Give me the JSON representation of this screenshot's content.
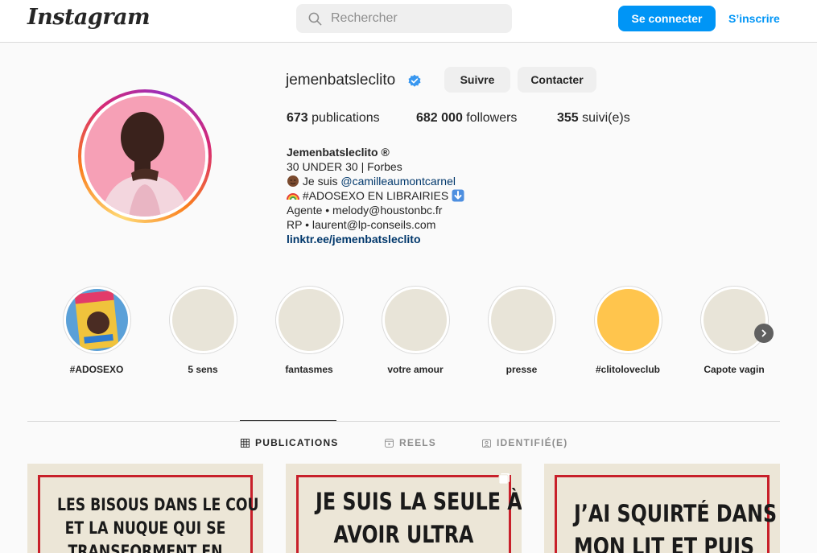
{
  "header": {
    "logo": "Instagram",
    "search_placeholder": "Rechercher",
    "login_label": "Se connecter",
    "signup_label": "S’inscrire"
  },
  "profile": {
    "username": "jemenbatsleclito",
    "verified": true,
    "follow_label": "Suivre",
    "contact_label": "Contacter",
    "stats": {
      "posts_count": "673",
      "posts_label": "publications",
      "followers_count": "682 000",
      "followers_label": "followers",
      "following_count": "355",
      "following_label": "suivi(e)s"
    },
    "bio": {
      "name": "Jemenbatsleclito ®",
      "line1": "30 UNDER 30 | Forbes",
      "line2_prefix": "Je suis ",
      "line2_mention": "@camilleaumontcarnel",
      "line3": "#ADOSEXO EN LIBRAIRIES",
      "line4": "Agente • melody@houstonbc.fr",
      "line5": "RP • laurent@lp-conseils.com",
      "link": "linktr.ee/jemenbatsleclito"
    }
  },
  "highlights": [
    {
      "label": "#ADOSEXO",
      "color": "#e8e4d8"
    },
    {
      "label": "5 sens",
      "color": "#e8e4d8"
    },
    {
      "label": "fantasmes",
      "color": "#e8e4d8"
    },
    {
      "label": "votre amour",
      "color": "#e8e4d8"
    },
    {
      "label": "presse",
      "color": "#e8e4d8"
    },
    {
      "label": "#clitoloveclub",
      "color": "#ffc54d"
    },
    {
      "label": "Capote vagin",
      "color": "#e8e4d8"
    }
  ],
  "tabs": {
    "publications": "PUBLICATIONS",
    "reels": "REELS",
    "tagged": "IDENTIFIÉ(E)"
  },
  "posts": [
    {
      "lines": [
        "LES BISOUS DANS LE COU",
        "ET LA NUQUE QUI SE",
        "TRANSFORMENT EN"
      ]
    },
    {
      "lines": [
        "JE SUIS LA SEULE À",
        "AVOIR ULTRA"
      ]
    },
    {
      "lines": [
        "J’AI SQUIRTÉ DANS",
        "MON LIT ET PUIS"
      ]
    }
  ],
  "colors": {
    "accent": "#0095f6",
    "post_border": "#c8202a",
    "post_bg": "#ece6d7"
  }
}
